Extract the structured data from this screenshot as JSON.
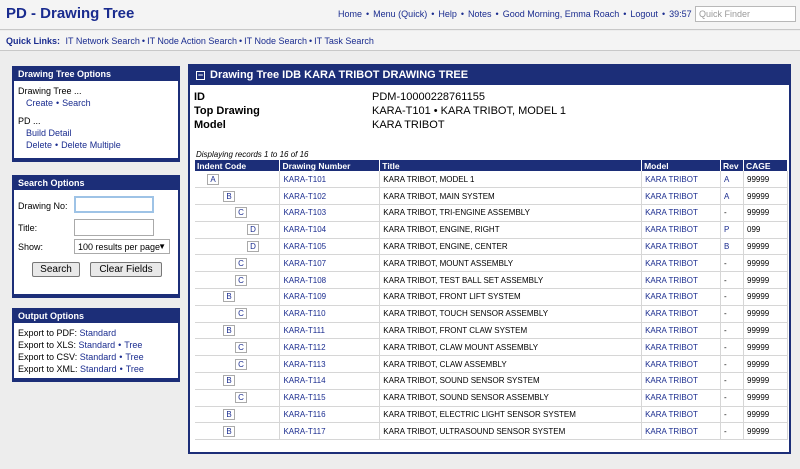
{
  "header": {
    "title": "PD - Drawing Tree",
    "nav": [
      "Home",
      "Menu (Quick)",
      "Help",
      "Notes"
    ],
    "greeting": "Good Morning, Emma Roach",
    "logout": "Logout",
    "timer": "39:57",
    "quick_finder_placeholder": "Quick Finder"
  },
  "quicklinks": {
    "label": "Quick Links:",
    "links": [
      "IT Network Search",
      "IT Node Action Search",
      "IT Node Search",
      "IT Task Search"
    ]
  },
  "drawing_tree_options": {
    "title": "Drawing Tree Options",
    "group1": "Drawing Tree ...",
    "create": "Create",
    "search": "Search",
    "group2": "PD ...",
    "build_detail": "Build Detail",
    "delete": "Delete",
    "delete_multiple": "Delete Multiple"
  },
  "search_options": {
    "title": "Search Options",
    "drawing_no_label": "Drawing No:",
    "drawing_no_value": "",
    "title_label": "Title:",
    "title_value": "",
    "show_label": "Show:",
    "show_value": "100 results per page",
    "search_button": "Search",
    "clear_button": "Clear Fields"
  },
  "output_options": {
    "title": "Output Options",
    "rows": [
      {
        "label": "Export to PDF:",
        "links": [
          "Standard"
        ]
      },
      {
        "label": "Export to XLS:",
        "links": [
          "Standard",
          "Tree"
        ]
      },
      {
        "label": "Export to CSV:",
        "links": [
          "Standard",
          "Tree"
        ]
      },
      {
        "label": "Export to XML:",
        "links": [
          "Standard",
          "Tree"
        ]
      }
    ]
  },
  "main": {
    "title": "Drawing Tree IDB KARA TRIBOT DRAWING TREE",
    "collapse_glyph": "−",
    "info": {
      "id_label": "ID",
      "id_value": "PDM-10000228761155",
      "top_label": "Top Drawing",
      "top_value": "KARA-T101 • KARA TRIBOT, MODEL 1",
      "model_label": "Model",
      "model_value": "KARA TRIBOT"
    },
    "records_note": "Displaying records 1 to 16 of 16",
    "columns": [
      "Indent Code",
      "Drawing Number",
      "Title",
      "Model",
      "Rev",
      "CAGE"
    ],
    "rows": [
      {
        "indent": "A",
        "level": 0,
        "number": "KARA-T101",
        "title": "KARA TRIBOT, MODEL 1",
        "model": "KARA TRIBOT",
        "rev": "A",
        "cage": "99999"
      },
      {
        "indent": "B",
        "level": 1,
        "number": "KARA-T102",
        "title": "KARA TRIBOT, MAIN SYSTEM",
        "model": "KARA TRIBOT",
        "rev": "A",
        "cage": "99999"
      },
      {
        "indent": "C",
        "level": 2,
        "number": "KARA-T103",
        "title": "KARA TRIBOT, TRI-ENGINE ASSEMBLY",
        "model": "KARA TRIBOT",
        "rev": "-",
        "cage": "99999"
      },
      {
        "indent": "D",
        "level": 3,
        "number": "KARA-T104",
        "title": "KARA TRIBOT, ENGINE, RIGHT",
        "model": "KARA TRIBOT",
        "rev": "P",
        "cage": "099"
      },
      {
        "indent": "D",
        "level": 3,
        "number": "KARA-T105",
        "title": "KARA TRIBOT, ENGINE, CENTER",
        "model": "KARA TRIBOT",
        "rev": "B",
        "cage": "99999"
      },
      {
        "indent": "C",
        "level": 2,
        "number": "KARA-T107",
        "title": "KARA TRIBOT, MOUNT ASSEMBLY",
        "model": "KARA TRIBOT",
        "rev": "-",
        "cage": "99999"
      },
      {
        "indent": "C",
        "level": 2,
        "number": "KARA-T108",
        "title": "KARA TRIBOT, TEST BALL SET ASSEMBLY",
        "model": "KARA TRIBOT",
        "rev": "-",
        "cage": "99999"
      },
      {
        "indent": "B",
        "level": 1,
        "number": "KARA-T109",
        "title": "KARA TRIBOT, FRONT LIFT SYSTEM",
        "model": "KARA TRIBOT",
        "rev": "-",
        "cage": "99999"
      },
      {
        "indent": "C",
        "level": 2,
        "number": "KARA-T110",
        "title": "KARA TRIBOT, TOUCH SENSOR ASSEMBLY",
        "model": "KARA TRIBOT",
        "rev": "-",
        "cage": "99999"
      },
      {
        "indent": "B",
        "level": 1,
        "number": "KARA-T111",
        "title": "KARA TRIBOT, FRONT CLAW SYSTEM",
        "model": "KARA TRIBOT",
        "rev": "-",
        "cage": "99999"
      },
      {
        "indent": "C",
        "level": 2,
        "number": "KARA-T112",
        "title": "KARA TRIBOT, CLAW MOUNT ASSEMBLY",
        "model": "KARA TRIBOT",
        "rev": "-",
        "cage": "99999"
      },
      {
        "indent": "C",
        "level": 2,
        "number": "KARA-T113",
        "title": "KARA TRIBOT, CLAW ASSEMBLY",
        "model": "KARA TRIBOT",
        "rev": "-",
        "cage": "99999"
      },
      {
        "indent": "B",
        "level": 1,
        "number": "KARA-T114",
        "title": "KARA TRIBOT, SOUND SENSOR SYSTEM",
        "model": "KARA TRIBOT",
        "rev": "-",
        "cage": "99999"
      },
      {
        "indent": "C",
        "level": 2,
        "number": "KARA-T115",
        "title": "KARA TRIBOT, SOUND SENSOR ASSEMBLY",
        "model": "KARA TRIBOT",
        "rev": "-",
        "cage": "99999"
      },
      {
        "indent": "B",
        "level": 1,
        "number": "KARA-T116",
        "title": "KARA TRIBOT, ELECTRIC LIGHT SENSOR SYSTEM",
        "model": "KARA TRIBOT",
        "rev": "-",
        "cage": "99999"
      },
      {
        "indent": "B",
        "level": 1,
        "number": "KARA-T117",
        "title": "KARA TRIBOT, ULTRASOUND SENSOR SYSTEM",
        "model": "KARA TRIBOT",
        "rev": "-",
        "cage": "99999"
      }
    ]
  },
  "colors": {
    "brand_navy": "#1c2e78",
    "link_blue": "#1a2c8f",
    "background": "#ededed"
  }
}
